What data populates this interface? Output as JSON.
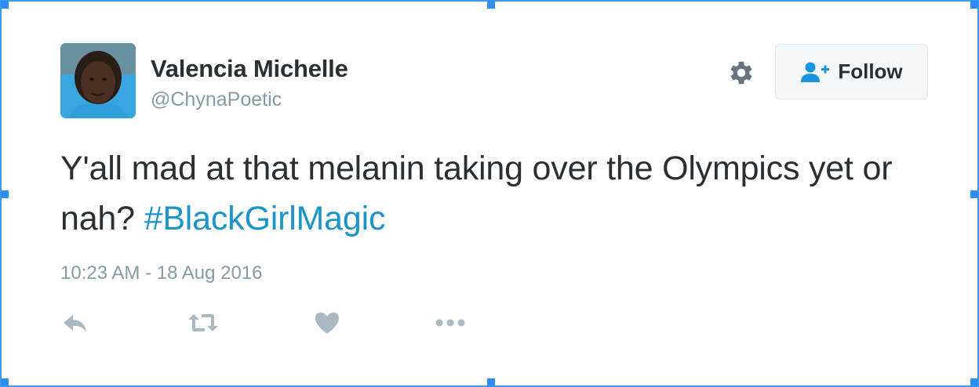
{
  "tweet": {
    "display_name": "Valencia Michelle",
    "handle": "@ChynaPoetic",
    "text_part1": "Y'all mad at that melanin taking over the Olympics yet or nah?",
    "hashtag": "#BlackGirlMagic",
    "timestamp": "10:23 AM - 18 Aug 2016"
  },
  "header": {
    "follow_label": "Follow",
    "settings_icon": "gear-icon",
    "follow_icon": "add-user-icon"
  },
  "actions": {
    "reply_icon": "reply-icon",
    "retweet_icon": "retweet-icon",
    "like_icon": "heart-icon",
    "more_icon": "more-dots-icon"
  },
  "colors": {
    "accent": "#1b95c9",
    "text": "#292f33",
    "muted": "#8899a6",
    "selection": "#3d99ee"
  }
}
